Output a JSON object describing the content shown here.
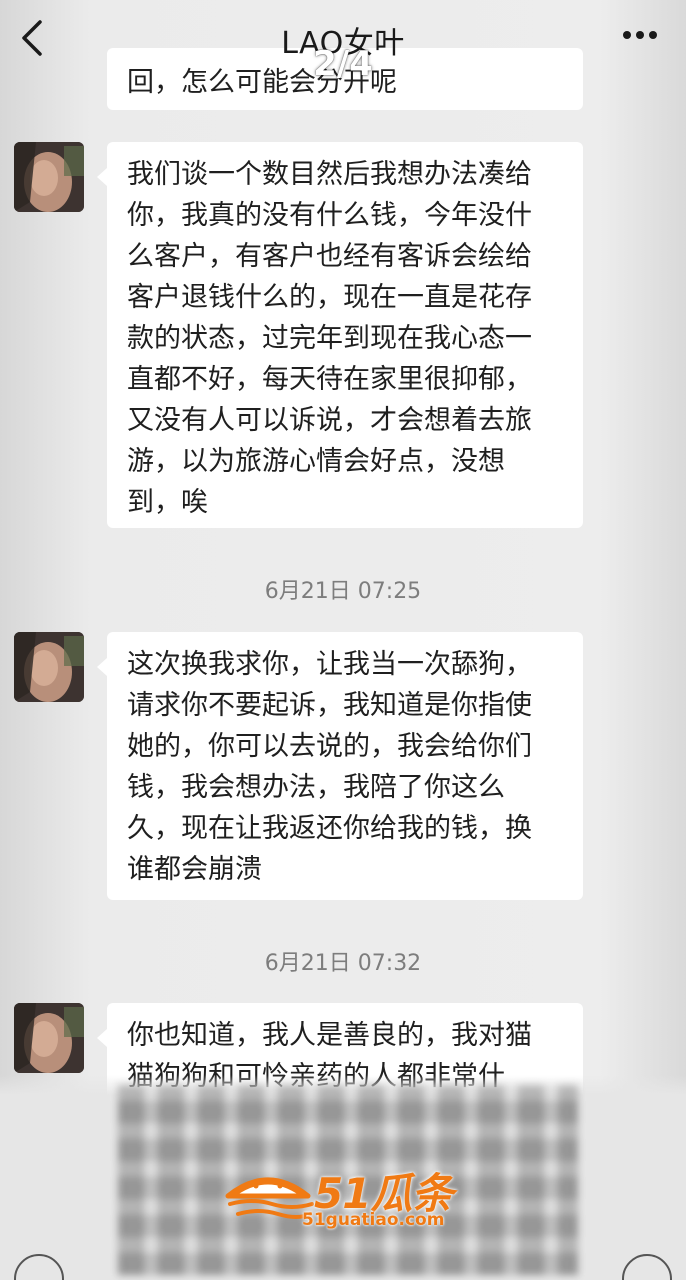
{
  "header": {
    "title": "LAO女叶",
    "page_indicator": "2/4",
    "back_icon": "chevron-left-icon",
    "more_icon": "more-dots-icon"
  },
  "messages": {
    "partial_top": "回，怎么可能会分开呢",
    "msg1": {
      "lines": [
        "我们谈一个数目然后我想办法凑给",
        "你，我真的没有什么钱，今年没什",
        "么客户，有客户也经有客诉会绘给",
        "客户退钱什么的，现在一直是花存",
        "款的状态，过完年到现在我心态一",
        "直都不好，每天待在家里很抑郁，",
        "又没有人可以诉说，才会想着去旅",
        "游，以为旅游心情会好点，没想",
        "到，唉"
      ]
    },
    "time1": "6月21日 07:25",
    "msg2": {
      "lines": [
        "这次换我求你，让我当一次舔狗，",
        "请求你不要起诉，我知道是你指使",
        "她的，你可以去说的，我会给你们",
        "钱，我会想办法，我陪了你这么",
        "久，现在让我返还你给我的钱，换",
        "谁都会崩溃"
      ]
    },
    "time2": "6月21日 07:32",
    "msg3": {
      "lines": [
        "你也知道，我人是善良的，我对猫",
        "猫狗狗和可怜亲药的人都非常什"
      ]
    }
  },
  "watermark": {
    "brand": "51瓜条",
    "url": "51guatiao.com",
    "color": "#f07a14"
  }
}
